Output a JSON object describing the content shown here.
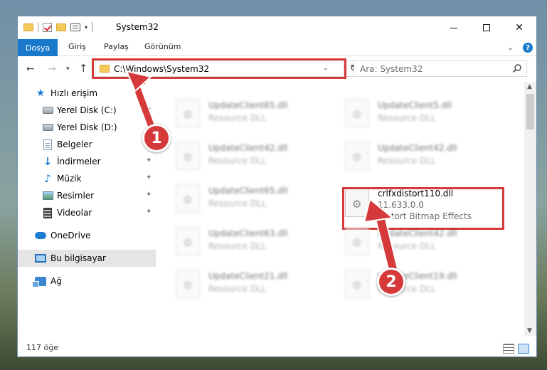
{
  "window": {
    "title": "System32"
  },
  "ribbon": {
    "tabs": [
      "Dosya",
      "Giriş",
      "Paylaş",
      "Görünüm"
    ],
    "help": "?"
  },
  "navbar": {
    "address": "C:\\Windows\\System32",
    "search_placeholder": "Ara: System32"
  },
  "sidebar": {
    "items": [
      {
        "label": "Hızlı erişim",
        "icon": "star-icon"
      },
      {
        "label": "Yerel Disk (C:)",
        "icon": "drive-icon"
      },
      {
        "label": "Yerel Disk (D:)",
        "icon": "drive-icon"
      },
      {
        "label": "Belgeler",
        "icon": "documents-icon"
      },
      {
        "label": "İndirmeler",
        "icon": "download-icon"
      },
      {
        "label": "Müzik",
        "icon": "music-icon"
      },
      {
        "label": "Resimler",
        "icon": "pictures-icon"
      },
      {
        "label": "Videolar",
        "icon": "videos-icon"
      },
      {
        "label": "OneDrive",
        "icon": "cloud-icon"
      },
      {
        "label": "Bu bilgisayar",
        "icon": "computer-icon"
      },
      {
        "label": "Ağ",
        "icon": "network-icon"
      }
    ]
  },
  "files": [
    {
      "name": "UpdateClient65.dll",
      "desc": "Resource DLL"
    },
    {
      "name": "UpdateClient5.dll",
      "desc": "Resource DLL"
    },
    {
      "name": "UpdateClient42.dll",
      "desc": "Resource DLL"
    },
    {
      "name": "UpdateClient42.dll",
      "desc": "Resource DLL"
    },
    {
      "name": "UpdateClient65.dll",
      "desc": "Resource DLL"
    },
    {
      "name": "UpdateClient63.dll",
      "desc": "Resource DLL"
    },
    {
      "name": "UpdateClient42.dll",
      "desc": "Resource DLL"
    },
    {
      "name": "UpdateClient21.dll",
      "desc": "Resource DLL"
    },
    {
      "name": "UpdateClient19.dll",
      "desc": "Resource DLL"
    }
  ],
  "target_file": {
    "name": "crlfxdistort110.dll",
    "version": "11.633.0.0",
    "desc": "Distort Bitmap Effects"
  },
  "status": {
    "count": "117 öğe"
  },
  "annotations": {
    "step1": "1",
    "step2": "2",
    "color": "#d6393a"
  }
}
